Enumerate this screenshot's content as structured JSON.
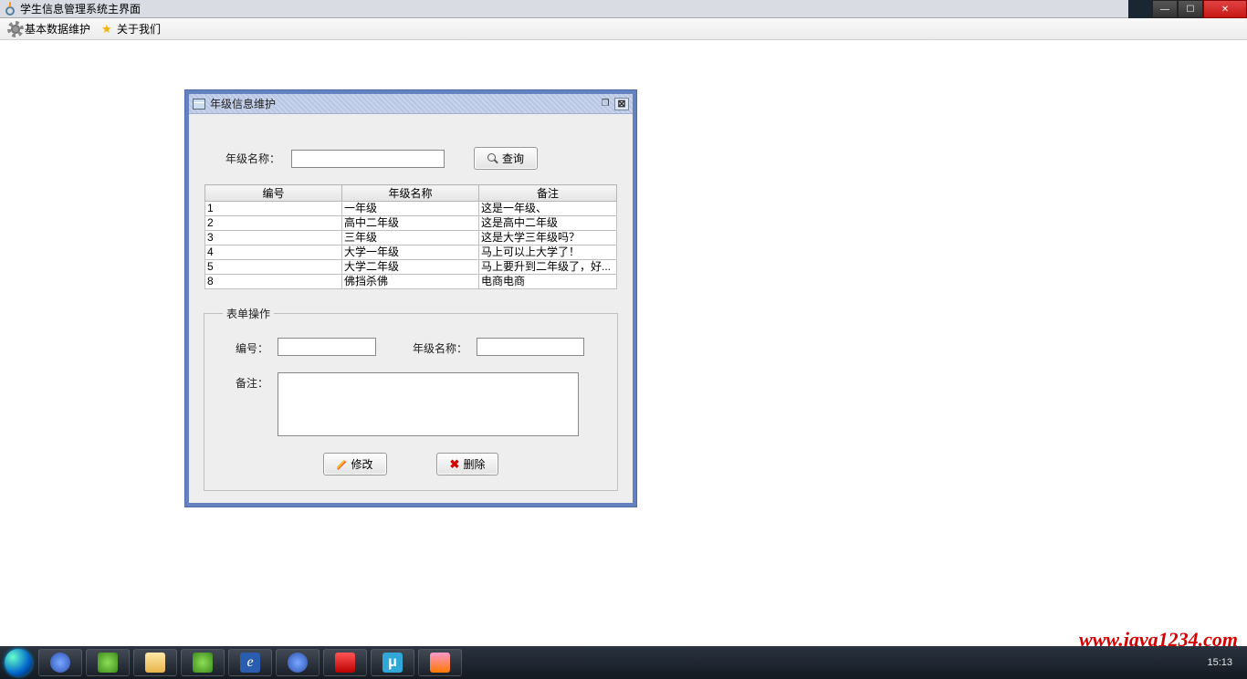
{
  "window": {
    "title": "学生信息管理系统主界面"
  },
  "menu": {
    "data_maintain": "基本数据维护",
    "about": "关于我们"
  },
  "internal": {
    "title": "年级信息维护",
    "search": {
      "label": "年级名称：",
      "value": "",
      "button": "查询"
    },
    "table": {
      "headers": {
        "id": "编号",
        "name": "年级名称",
        "remark": "备注"
      },
      "rows": [
        {
          "id": "1",
          "name": "一年级",
          "remark": "这是一年级、"
        },
        {
          "id": "2",
          "name": "高中二年级",
          "remark": "这是高中二年级"
        },
        {
          "id": "3",
          "name": "三年级",
          "remark": "这是大学三年级吗？"
        },
        {
          "id": "4",
          "name": "大学一年级",
          "remark": "马上可以上大学了！"
        },
        {
          "id": "5",
          "name": "大学二年级",
          "remark": "马上要升到二年级了，好..."
        },
        {
          "id": "8",
          "name": "佛挡杀佛",
          "remark": "电商电商"
        }
      ]
    },
    "form": {
      "legend": "表单操作",
      "id_label": "编号：",
      "id_value": "",
      "name_label": "年级名称：",
      "name_value": "",
      "remark_label": "备注：",
      "remark_value": "",
      "modify": "修改",
      "delete": "删除"
    }
  },
  "watermark": "www.java1234.com",
  "taskbar": {
    "time": "15:13"
  }
}
